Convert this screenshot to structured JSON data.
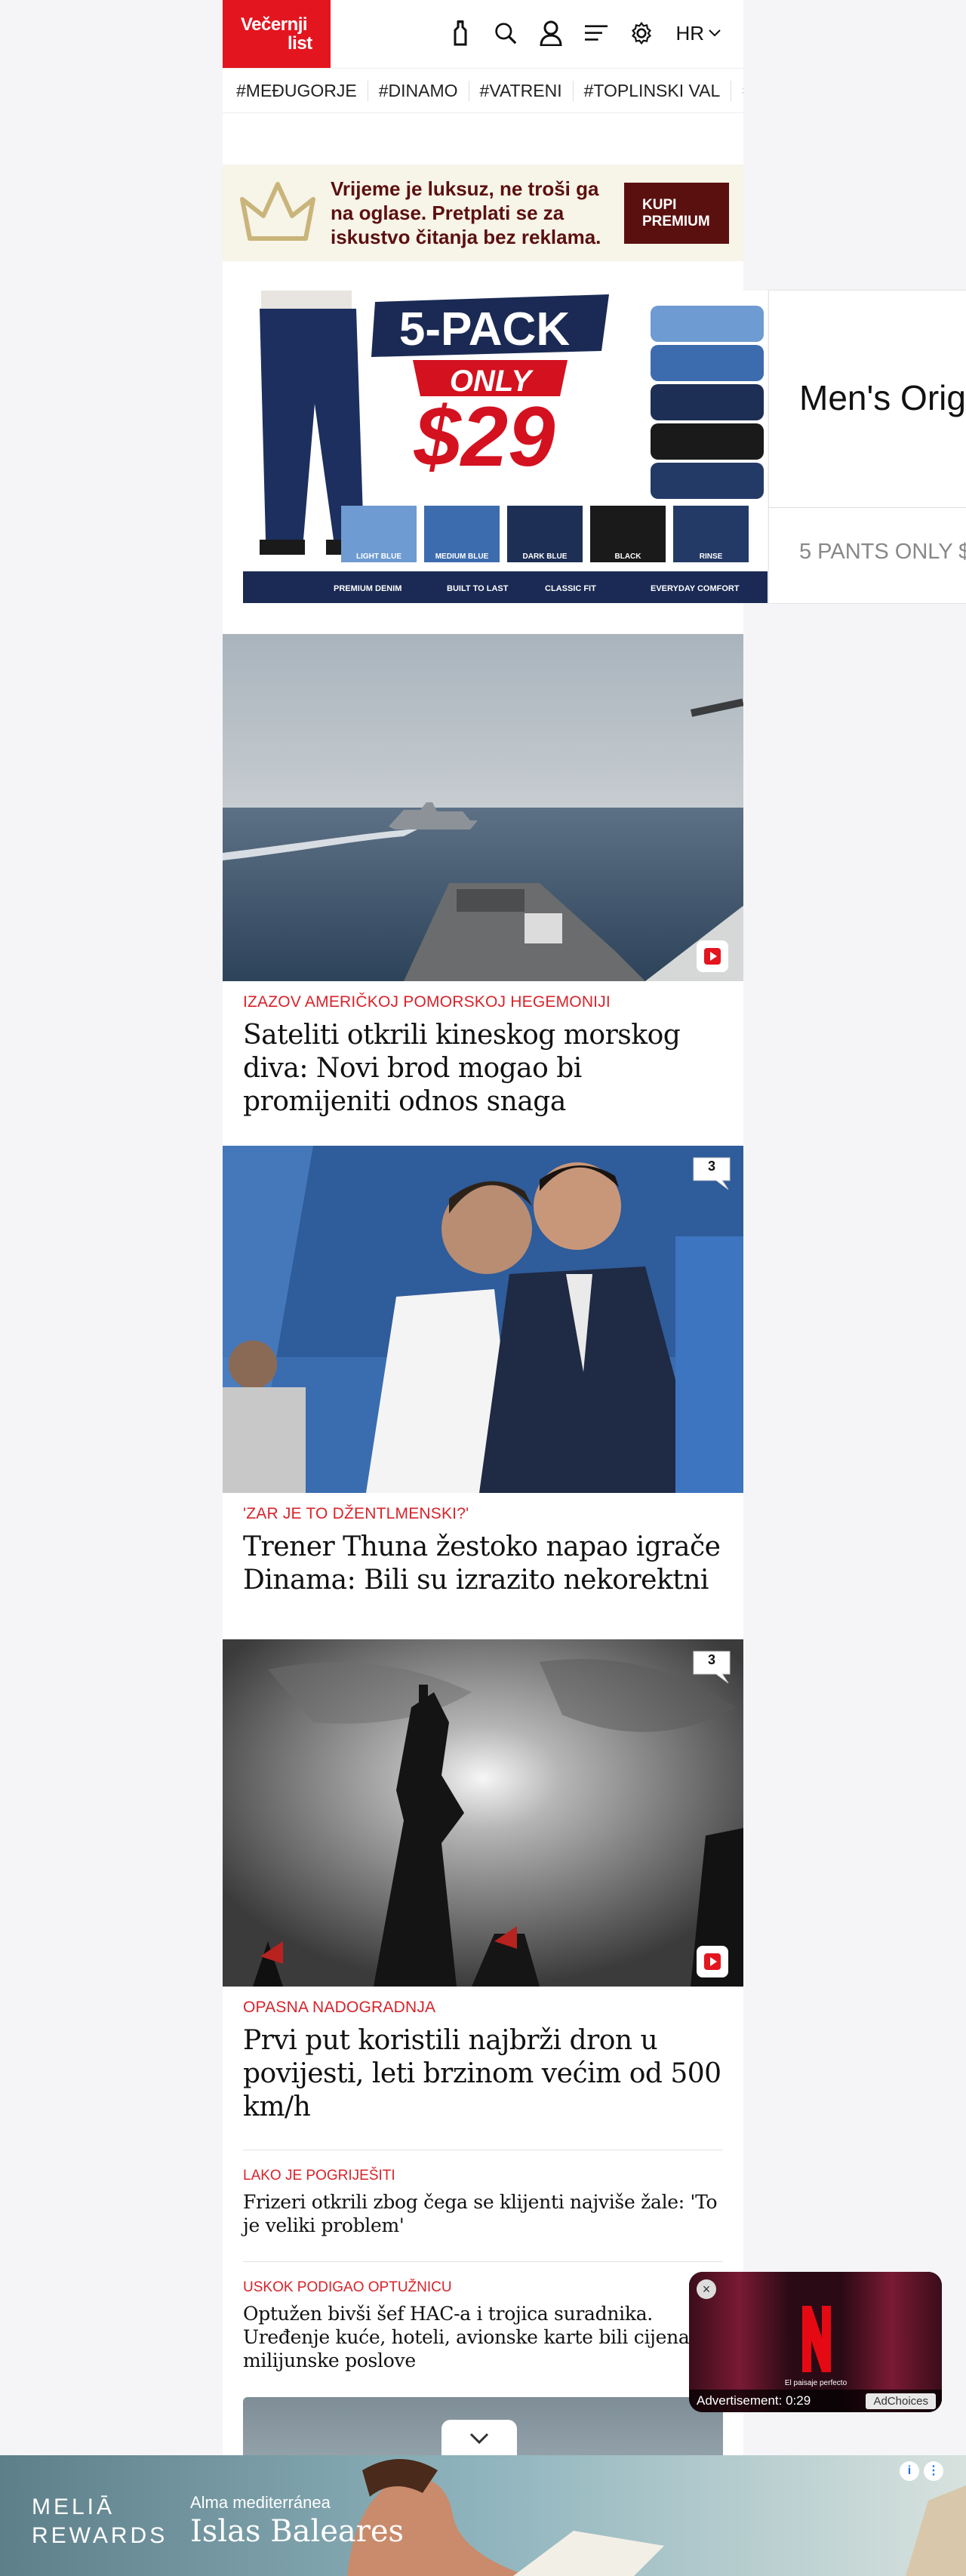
{
  "header": {
    "logo_line1": "Večernji",
    "logo_line2": "list",
    "lang": "HR"
  },
  "tags": [
    "#MEĐUGORJE",
    "#DINAMO",
    "#VATRENI",
    "#TOPLINSKI VAL",
    "#"
  ],
  "promo": {
    "text": "Vrijeme je luksuz, ne troši ga na oglase. Pretplati se za iskustvo čitanja bez reklama.",
    "button_line1": "KUPI",
    "button_line2": "PREMIUM"
  },
  "ad_banner": {
    "pack": "5-PACK",
    "only": "ONLY",
    "price": "$29",
    "colors": [
      "LIGHT BLUE",
      "MEDIUM BLUE",
      "DARK BLUE",
      "BLACK",
      "RINSE"
    ],
    "features": [
      "PREMIUM DENIM",
      "BUILT TO LAST",
      "CLASSIC FIT",
      "EVERYDAY COMFORT"
    ],
    "side_title": "Men's Orig",
    "side_sub": "5 PANTS ONLY $"
  },
  "articles": [
    {
      "kicker": "IZAZOV AMERIČKOJ POMORSKOJ HEGEMONIJI",
      "title": "Sateliti otkrili kineskog morskog diva: Novi brod mogao bi promijeniti odnos snaga"
    },
    {
      "kicker": "'ZAR JE TO DŽENTLMENSKI?'",
      "title": "Trener Thuna žestoko napao igrače Dinama: Bili su izrazito nekorektni",
      "comments": "3"
    },
    {
      "kicker": "OPASNA NADOGRADNJA",
      "title": "Prvi put koristili najbrži dron u povijesti, leti brzinom većim od 500 km/h",
      "comments": "3"
    }
  ],
  "small_articles": [
    {
      "kicker": "LAKO JE POGRIJEŠITI",
      "title": "Frizeri otkrili zbog čega se klijenti najviše žale: 'To je veliki problem'"
    },
    {
      "kicker": "USKOK PODIGAO OPTUŽNICU",
      "title": "Optužen bivši šef HAC-a i trojica suradnika. Uređenje kuće, hoteli, avionske karte bili cijena za milijunske poslove"
    }
  ],
  "video_ad": {
    "caption": "El paisaje perfecto",
    "label": "Advertisement: 0:29",
    "adchoices": "AdChoices"
  },
  "bottom_ad": {
    "brand_line1": "MELIĀ",
    "brand_line2": "REWARDS",
    "sub1": "Alma mediterránea",
    "sub2": "Islas Baleares"
  }
}
